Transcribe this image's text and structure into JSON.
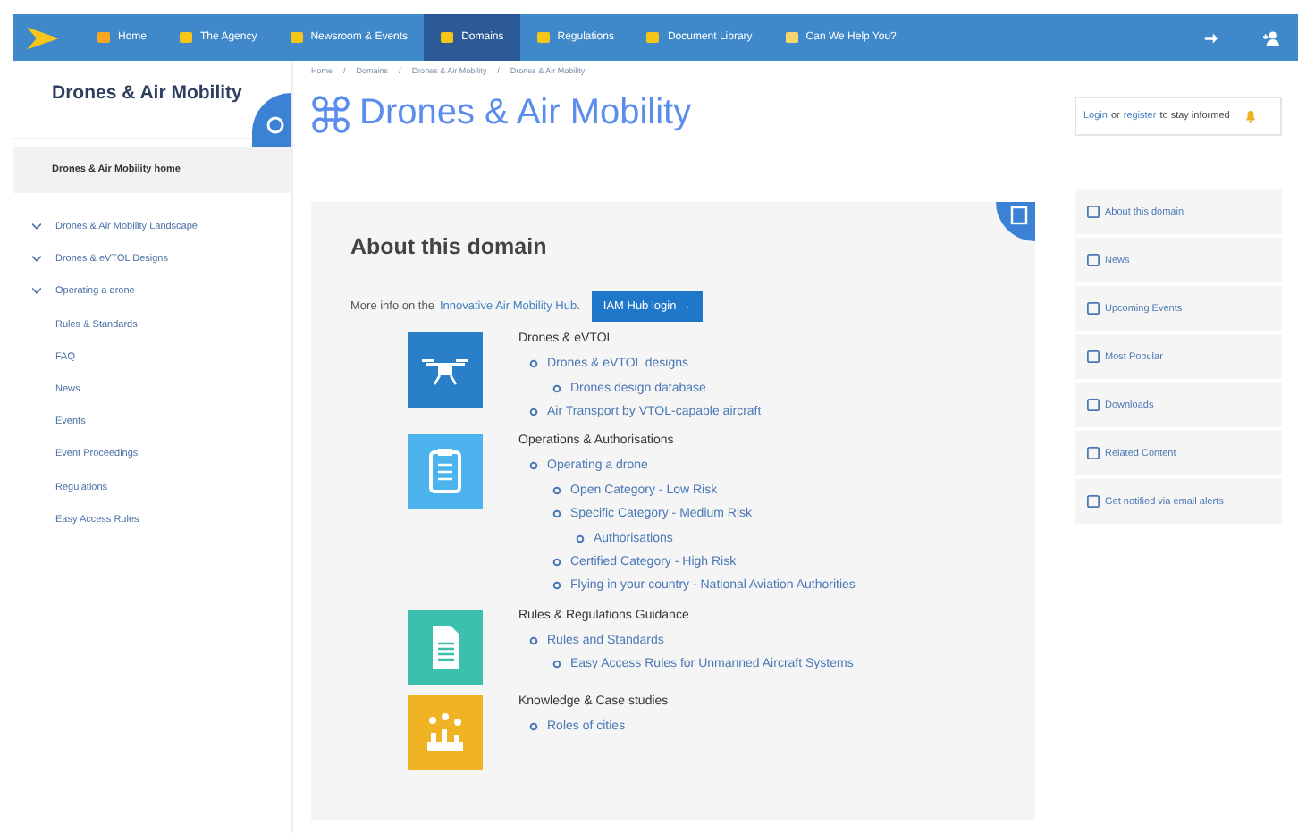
{
  "nav": {
    "items": [
      {
        "label": "Home",
        "selected": false
      },
      {
        "label": "The Agency",
        "selected": false
      },
      {
        "label": "Newsroom & Events",
        "selected": false
      },
      {
        "label": "Domains",
        "selected": true
      },
      {
        "label": "Regulations",
        "selected": false
      },
      {
        "label": "Document Library",
        "selected": false
      },
      {
        "label": "Can We Help You?",
        "selected": false
      }
    ]
  },
  "sidebar": {
    "title": "Drones & Air Mobility",
    "home": "Drones & Air Mobility home",
    "items": [
      {
        "label": "Drones & Air Mobility Landscape",
        "expandable": true
      },
      {
        "label": "Drones & eVTOL Designs",
        "expandable": true
      },
      {
        "label": "Operating a drone",
        "expandable": true
      },
      {
        "label": "Rules & Standards",
        "expandable": false
      },
      {
        "label": "FAQ",
        "expandable": false
      },
      {
        "label": "News",
        "expandable": false
      },
      {
        "label": "Events",
        "expandable": false
      },
      {
        "label": "Event Proceedings",
        "expandable": false
      },
      {
        "label": "Regulations",
        "expandable": false
      },
      {
        "label": "Easy Access Rules",
        "expandable": false
      }
    ]
  },
  "breadcrumb": [
    "Home",
    "Domains",
    "Drones & Air Mobility",
    "Drones & Air Mobility"
  ],
  "breadcrumb_separator": "/",
  "page_title": "Drones & Air Mobility",
  "subscribe": {
    "login": "Login",
    "middle": "or",
    "register": "register",
    "rest": "to stay informed"
  },
  "about": {
    "title": "About this domain",
    "intro": "More info on the",
    "hub_link": "Innovative Air Mobility Hub",
    "intro_end": ".",
    "button": "IAM Hub login →",
    "sections": [
      {
        "kind": "drone",
        "color": "#2a7fc9",
        "heading": "Drones & eVTOL",
        "links": [
          {
            "label": "Drones & eVTOL designs",
            "children": [
              {
                "label": "Drones design database"
              }
            ]
          },
          {
            "label": "Air Transport by VTOL-capable aircraft"
          }
        ]
      },
      {
        "kind": "clipboard",
        "color": "#4db3ef",
        "heading": "Operations & Authorisations",
        "links": [
          {
            "label": "Operating a drone",
            "children": [
              {
                "label": "Open Category - Low Risk"
              },
              {
                "label": "Specific Category - Medium Risk",
                "children": [
                  {
                    "label": "Authorisations"
                  }
                ]
              },
              {
                "label": "Certified Category - High Risk"
              },
              {
                "label": "Flying in your country - National Aviation Authorities"
              }
            ]
          }
        ]
      },
      {
        "kind": "document",
        "color": "#3dbfad",
        "heading": "Rules & Regulations Guidance",
        "links": [
          {
            "label": "Rules and Standards",
            "children": [
              {
                "label": "Easy Access Rules for Unmanned Aircraft Systems"
              }
            ]
          }
        ]
      },
      {
        "kind": "city",
        "color": "#f0b323",
        "heading": "Knowledge & Case studies",
        "links": [
          {
            "label": "Roles of cities"
          }
        ]
      }
    ]
  },
  "side_links": [
    "About this domain",
    "News",
    "Upcoming Events",
    "Most Popular",
    "Downloads",
    "Related Content",
    "Get notified via email alerts"
  ]
}
